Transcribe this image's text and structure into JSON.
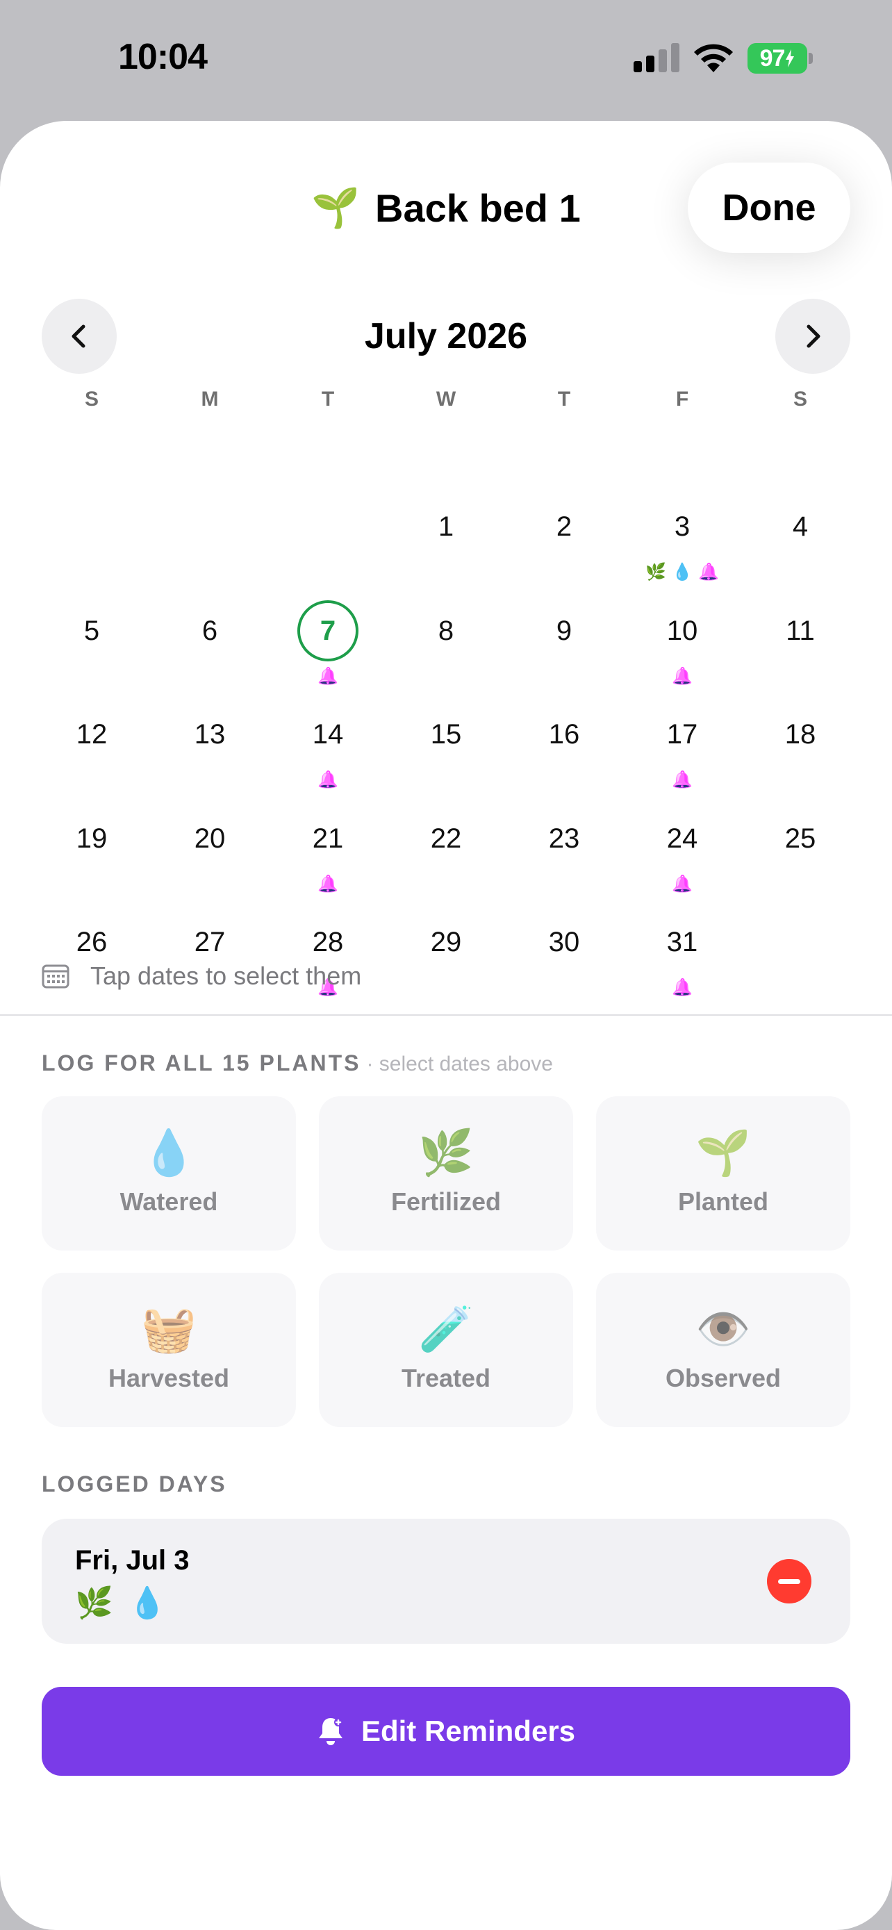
{
  "status_bar": {
    "time": "10:04",
    "battery": "97"
  },
  "header": {
    "icon": "🌱",
    "title": "Back bed 1",
    "done_label": "Done"
  },
  "calendar": {
    "month_title": "July 2026",
    "weekdays": [
      "S",
      "M",
      "T",
      "W",
      "T",
      "F",
      "S"
    ],
    "leading_blanks": 3,
    "today": 7,
    "days": [
      {
        "day": "1",
        "markers": []
      },
      {
        "day": "2",
        "markers": []
      },
      {
        "day": "3",
        "markers": [
          "🌿",
          "💧",
          "🔔"
        ]
      },
      {
        "day": "4",
        "markers": []
      },
      {
        "day": "5",
        "markers": []
      },
      {
        "day": "6",
        "markers": []
      },
      {
        "day": "7",
        "markers": [
          "🔔"
        ]
      },
      {
        "day": "8",
        "markers": []
      },
      {
        "day": "9",
        "markers": []
      },
      {
        "day": "10",
        "markers": [
          "🔔"
        ]
      },
      {
        "day": "11",
        "markers": []
      },
      {
        "day": "12",
        "markers": []
      },
      {
        "day": "13",
        "markers": []
      },
      {
        "day": "14",
        "markers": [
          "🔔"
        ]
      },
      {
        "day": "15",
        "markers": []
      },
      {
        "day": "16",
        "markers": []
      },
      {
        "day": "17",
        "markers": [
          "🔔"
        ]
      },
      {
        "day": "18",
        "markers": []
      },
      {
        "day": "19",
        "markers": []
      },
      {
        "day": "20",
        "markers": []
      },
      {
        "day": "21",
        "markers": [
          "🔔"
        ]
      },
      {
        "day": "22",
        "markers": []
      },
      {
        "day": "23",
        "markers": []
      },
      {
        "day": "24",
        "markers": [
          "🔔"
        ]
      },
      {
        "day": "25",
        "markers": []
      },
      {
        "day": "26",
        "markers": []
      },
      {
        "day": "27",
        "markers": []
      },
      {
        "day": "28",
        "markers": [
          "🔔"
        ]
      },
      {
        "day": "29",
        "markers": []
      },
      {
        "day": "30",
        "markers": []
      },
      {
        "day": "31",
        "markers": [
          "🔔"
        ]
      }
    ],
    "hint": "Tap dates to select them"
  },
  "log_section": {
    "label": "LOG FOR ALL 15 PLANTS",
    "sublabel": "· select dates above",
    "actions": [
      {
        "emoji": "💧",
        "label": "Watered",
        "name": "watered"
      },
      {
        "emoji": "🌿",
        "label": "Fertilized",
        "name": "fertilized"
      },
      {
        "emoji": "🌱",
        "label": "Planted",
        "name": "planted"
      },
      {
        "emoji": "🧺",
        "label": "Harvested",
        "name": "harvested"
      },
      {
        "emoji": "🧪",
        "label": "Treated",
        "name": "treated"
      },
      {
        "emoji": "👁️",
        "label": "Observed",
        "name": "observed"
      }
    ]
  },
  "logged_days": {
    "label": "LOGGED DAYS",
    "entries": [
      {
        "date": "Fri, Jul 3",
        "icons": [
          "🌿",
          "💧"
        ]
      }
    ]
  },
  "reminders_button": {
    "label": "Edit Reminders"
  },
  "colors": {
    "accent": "#7a3be8",
    "today": "#1e9e4a",
    "marker": "#7a3be8",
    "remove": "#ff3b30"
  }
}
